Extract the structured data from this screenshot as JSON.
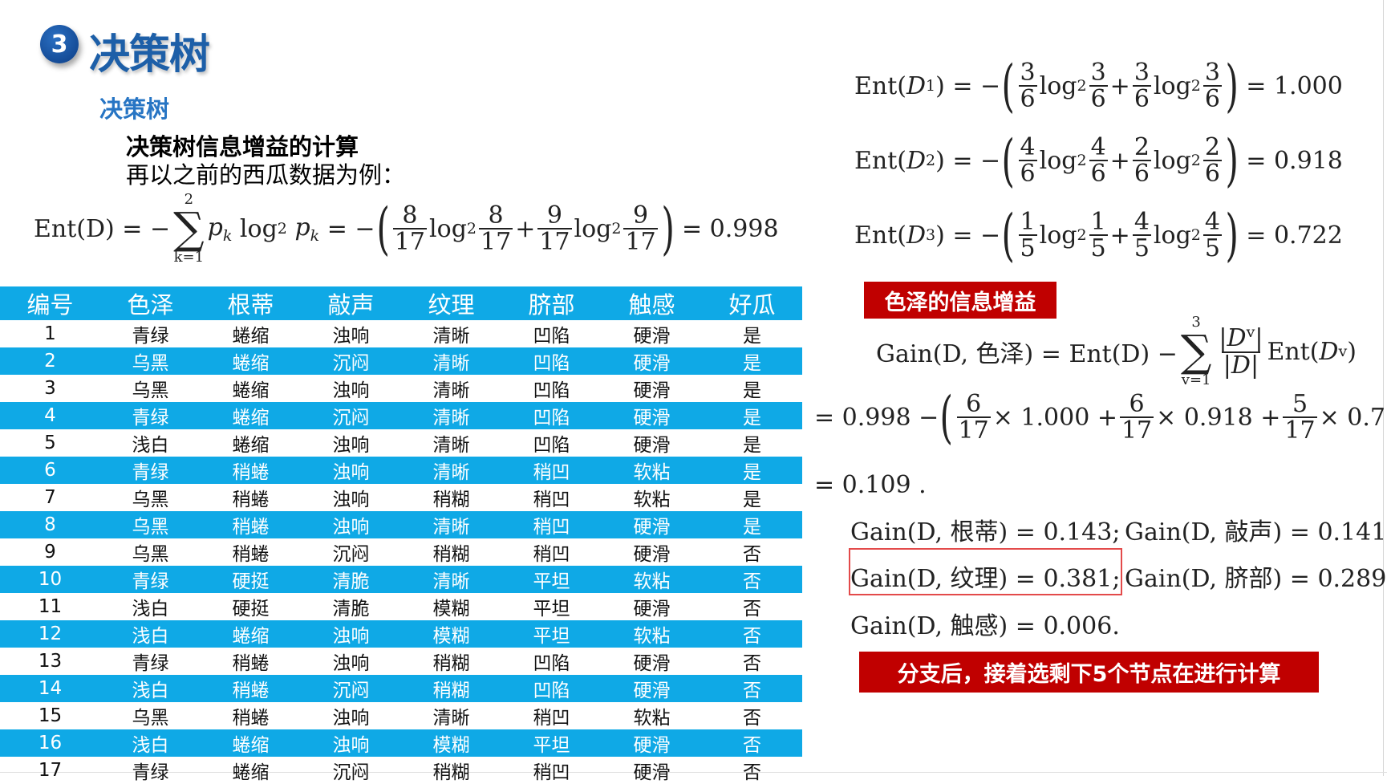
{
  "header": {
    "badge": "3",
    "title": "决策树",
    "subtitle": "决策树",
    "heading": "决策树信息增益的计算",
    "intro": "再以之前的西瓜数据为例："
  },
  "math": {
    "ent_D_lhs": "Ent(D) = −",
    "sum_top": "2",
    "sum_bottom": "k=1",
    "ent_D_result": "= 0.998",
    "ent_D1_result": "= 1.000",
    "ent_D2_result": "= 0.918",
    "ent_D3_result": "= 0.722",
    "gain_formula_lhs": "Gain(D, 色泽) = Ent(D) −",
    "gain_sum_top": "3",
    "gain_sum_bottom": "v=1",
    "gain_calc_start": "= 0.998 −",
    "gain_calc_end": "= 0.109 .",
    "gain_root": "Gain(D, 根蒂) = 0.143;",
    "gain_knock": "Gain(D, 敲声) = 0.141;",
    "gain_texture": "Gain(D, 纹理) = 0.381;",
    "gain_navel": "Gain(D, 脐部) = 0.289;",
    "gain_touch": "Gain(D, 触感) = 0.006."
  },
  "labels": {
    "color_gain": "色泽的信息增益",
    "next_step": "分支后，接着选剩下5个节点在进行计算"
  },
  "table": {
    "headers": [
      "编号",
      "色泽",
      "根蒂",
      "敲声",
      "纹理",
      "脐部",
      "触感",
      "好瓜"
    ],
    "rows": [
      [
        "1",
        "青绿",
        "蜷缩",
        "浊响",
        "清晰",
        "凹陷",
        "硬滑",
        "是"
      ],
      [
        "2",
        "乌黑",
        "蜷缩",
        "沉闷",
        "清晰",
        "凹陷",
        "硬滑",
        "是"
      ],
      [
        "3",
        "乌黑",
        "蜷缩",
        "浊响",
        "清晰",
        "凹陷",
        "硬滑",
        "是"
      ],
      [
        "4",
        "青绿",
        "蜷缩",
        "沉闷",
        "清晰",
        "凹陷",
        "硬滑",
        "是"
      ],
      [
        "5",
        "浅白",
        "蜷缩",
        "浊响",
        "清晰",
        "凹陷",
        "硬滑",
        "是"
      ],
      [
        "6",
        "青绿",
        "稍蜷",
        "浊响",
        "清晰",
        "稍凹",
        "软粘",
        "是"
      ],
      [
        "7",
        "乌黑",
        "稍蜷",
        "浊响",
        "稍糊",
        "稍凹",
        "软粘",
        "是"
      ],
      [
        "8",
        "乌黑",
        "稍蜷",
        "浊响",
        "清晰",
        "稍凹",
        "硬滑",
        "是"
      ],
      [
        "9",
        "乌黑",
        "稍蜷",
        "沉闷",
        "稍糊",
        "稍凹",
        "硬滑",
        "否"
      ],
      [
        "10",
        "青绿",
        "硬挺",
        "清脆",
        "清晰",
        "平坦",
        "软粘",
        "否"
      ],
      [
        "11",
        "浅白",
        "硬挺",
        "清脆",
        "模糊",
        "平坦",
        "硬滑",
        "否"
      ],
      [
        "12",
        "浅白",
        "蜷缩",
        "浊响",
        "模糊",
        "平坦",
        "软粘",
        "否"
      ],
      [
        "13",
        "青绿",
        "稍蜷",
        "浊响",
        "稍糊",
        "凹陷",
        "硬滑",
        "否"
      ],
      [
        "14",
        "浅白",
        "稍蜷",
        "沉闷",
        "稍糊",
        "凹陷",
        "硬滑",
        "否"
      ],
      [
        "15",
        "乌黑",
        "稍蜷",
        "浊响",
        "清晰",
        "稍凹",
        "软粘",
        "否"
      ],
      [
        "16",
        "浅白",
        "蜷缩",
        "浊响",
        "模糊",
        "平坦",
        "硬滑",
        "否"
      ],
      [
        "17",
        "青绿",
        "蜷缩",
        "沉闷",
        "稍糊",
        "稍凹",
        "硬滑",
        "否"
      ]
    ]
  },
  "colors": {
    "title_blue": "#1d5fa8",
    "subtitle_blue": "#2775c4",
    "table_blue": "#0fa9e6",
    "label_red": "#c00000",
    "highlight_red": "#e34a4a"
  }
}
